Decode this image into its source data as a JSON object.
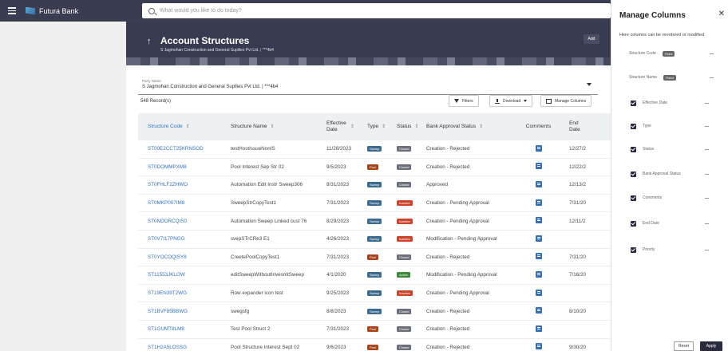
{
  "app": {
    "brand": "Futura Bank",
    "search_placeholder": "What would you like to do today?"
  },
  "header": {
    "title": "Account Structures",
    "subtitle": "S Jagmohan Construction and General Supllies Pvt Ltd. | ***4b4",
    "add_label": "Add"
  },
  "filters": {
    "party_label": "Party Name",
    "party_value": "S Jagmohan Construction and General Supllies Pvt Ltd. | ***4b4",
    "records": "548 Record(s)",
    "filters_label": "Filters",
    "download_label": "Download",
    "manage_columns_label": "Manage Columns"
  },
  "table": {
    "headers": {
      "code": "Structure Code",
      "name": "Structure Name",
      "date": "Effective Date",
      "type": "Type",
      "status": "Status",
      "approval": "Bank Approval Status",
      "comments": "Comments",
      "end": "End Date"
    },
    "rows": [
      {
        "code": "ST00E2CCT25KRNSOD",
        "name": "testHostIssueNonIS",
        "date": "11/28/2023",
        "type": "Sweep",
        "type_color": "#3d6b8f",
        "status": "Closed",
        "status_color": "#6b6f7b",
        "approval": "Creation - Rejected",
        "end": "12/27/2"
      },
      {
        "code": "ST0DOMMPXM8",
        "name": "Pool Interest Sep Str 02",
        "date": "9/5/2023",
        "type": "Pool",
        "type_color": "#a3461f",
        "status": "Closed",
        "status_color": "#6b6f7b",
        "approval": "Creation - Rejected",
        "end": "12/22/2"
      },
      {
        "code": "ST0FHLF2ZHWO",
        "name": "Automation Edit Instr Sweep306",
        "date": "8/31/2023",
        "type": "Sweep",
        "type_color": "#3d6b8f",
        "status": "Closed",
        "status_color": "#6b6f7b",
        "approval": "Approved",
        "end": "12/13/2"
      },
      {
        "code": "ST0MKP007IM8",
        "name": "SweepStrCopyTest1",
        "date": "7/31/2023",
        "type": "Sweep",
        "type_color": "#3d6b8f",
        "status": "Inactive",
        "status_color": "#c9462b",
        "approval": "Creation - Pending Approval",
        "end": "7/31/20"
      },
      {
        "code": "ST0NDORCQIS0",
        "name": "Automation Sweep Linked cust 76",
        "date": "8/29/2023",
        "type": "Sweep",
        "type_color": "#3d6b8f",
        "status": "Inactive",
        "status_color": "#c9462b",
        "approval": "Creation - Pending Approval",
        "end": "12/11/2"
      },
      {
        "code": "ST0V7I17PNGG",
        "name": "svepSTrCRe3 E1",
        "date": "4/26/2023",
        "type": "Sweep",
        "type_color": "#3d6b8f",
        "status": "Inactive",
        "status_color": "#c9462b",
        "approval": "Modification - Pending Approval",
        "end": ""
      },
      {
        "code": "ST0YOCOQISY8",
        "name": "CreetePoolCopyTest1",
        "date": "7/31/2023",
        "type": "Pool",
        "type_color": "#a3461f",
        "status": "Closed",
        "status_color": "#6b6f7b",
        "approval": "Creation - Rejected",
        "end": "7/31/20"
      },
      {
        "code": "ST11553JKLOW",
        "name": "editSweepWithoutInvesmtSweep",
        "date": "4/1/2020",
        "type": "Sweep",
        "type_color": "#3d6b8f",
        "status": "Active",
        "status_color": "#3f8a3a",
        "approval": "Modification - Pending Approval",
        "end": "7/16/20"
      },
      {
        "code": "ST19EN39T2WG",
        "name": "Row expander icon test",
        "date": "9/25/2023",
        "type": "Sweep",
        "type_color": "#3d6b8f",
        "status": "Inactive",
        "status_color": "#c9462b",
        "approval": "Creation - Pending Approval",
        "end": ""
      },
      {
        "code": "ST1BVF85BBWG",
        "name": "swegsfg",
        "date": "8/8/2023",
        "type": "Sweep",
        "type_color": "#3d6b8f",
        "status": "Closed",
        "status_color": "#6b6f7b",
        "approval": "Creation - Rejected",
        "end": "8/10/20"
      },
      {
        "code": "ST1GUMT8LM8",
        "name": "Test Pool Struct 2",
        "date": "7/31/2023",
        "type": "Pool",
        "type_color": "#a3461f",
        "status": "Closed",
        "status_color": "#6b6f7b",
        "approval": "Creation - Rejected",
        "end": ""
      },
      {
        "code": "ST1H2A5LOSSG",
        "name": "Pool Structure Interest Sept 02",
        "date": "9/6/2023",
        "type": "Pool",
        "type_color": "#a3461f",
        "status": "Closed",
        "status_color": "#6b6f7b",
        "approval": "Creation - Rejected",
        "end": "9/30/20"
      }
    ]
  },
  "panel": {
    "title": "Manage Columns",
    "description": "Here columns can be reordered or modified",
    "fixed_label": "Fixed",
    "columns": [
      {
        "label": "Structure Code",
        "fixed": true
      },
      {
        "label": "Structure Name",
        "fixed": true
      },
      {
        "label": "Effective Date",
        "fixed": false
      },
      {
        "label": "Type",
        "fixed": false
      },
      {
        "label": "Status",
        "fixed": false
      },
      {
        "label": "Bank Approval Status",
        "fixed": false
      },
      {
        "label": "Comments",
        "fixed": false
      },
      {
        "label": "End Date",
        "fixed": false
      },
      {
        "label": "Priority",
        "fixed": false
      }
    ],
    "reset_label": "Reset",
    "apply_label": "Apply"
  }
}
